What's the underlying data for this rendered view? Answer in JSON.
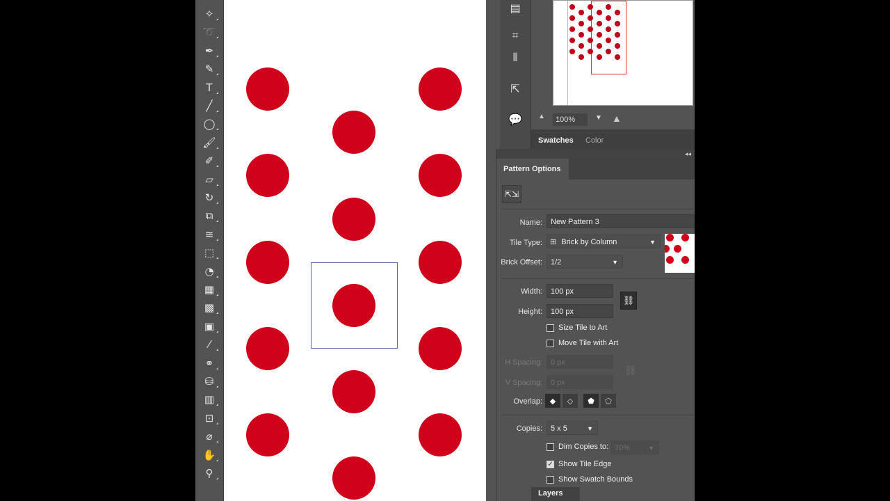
{
  "colors": {
    "panel_bg": "#535353",
    "field_bg": "#454545",
    "dot_red": "#d0021b",
    "tile_edge": "#5a64a0"
  },
  "toolbar": {
    "tools": [
      {
        "name": "magic-wand-icon",
        "glyph": "✧"
      },
      {
        "name": "lasso-icon",
        "glyph": "➰"
      },
      {
        "name": "pen-icon",
        "glyph": "✒"
      },
      {
        "name": "curvature-icon",
        "glyph": "✎"
      },
      {
        "name": "type-icon",
        "glyph": "T"
      },
      {
        "name": "line-icon",
        "glyph": "╱"
      },
      {
        "name": "ellipse-icon",
        "glyph": "◯"
      },
      {
        "name": "paintbrush-icon",
        "glyph": "🖌"
      },
      {
        "name": "shaper-icon",
        "glyph": "✐"
      },
      {
        "name": "eraser-icon",
        "glyph": "▱"
      },
      {
        "name": "rotate-icon",
        "glyph": "↻"
      },
      {
        "name": "scale-icon",
        "glyph": "⧉"
      },
      {
        "name": "warp-icon",
        "glyph": "≋"
      },
      {
        "name": "free-transform-icon",
        "glyph": "⬚"
      },
      {
        "name": "shape-builder-icon",
        "glyph": "◔"
      },
      {
        "name": "perspective-grid-icon",
        "glyph": "▦"
      },
      {
        "name": "mesh-icon",
        "glyph": "▩"
      },
      {
        "name": "gradient-icon",
        "glyph": "▣"
      },
      {
        "name": "eyedropper-icon",
        "glyph": "⁄"
      },
      {
        "name": "blend-icon",
        "glyph": "⚭"
      },
      {
        "name": "symbol-sprayer-icon",
        "glyph": "⛁"
      },
      {
        "name": "column-graph-icon",
        "glyph": "▥"
      },
      {
        "name": "artboard-icon",
        "glyph": "⊡"
      },
      {
        "name": "slice-icon",
        "glyph": "⌀"
      },
      {
        "name": "hand-icon",
        "glyph": "✋"
      },
      {
        "name": "zoom-icon",
        "glyph": "⚲"
      }
    ]
  },
  "dock_icons": [
    {
      "name": "gradient-panel-icon",
      "glyph": "▤"
    },
    {
      "name": "transform-panel-icon",
      "glyph": "⌗"
    },
    {
      "name": "align-panel-icon",
      "glyph": "⫴"
    },
    {
      "name": "export-panel-icon",
      "glyph": "⇱"
    },
    {
      "name": "comments-panel-icon",
      "glyph": "💬"
    }
  ],
  "navigator": {
    "zoom": "100%"
  },
  "panel_tabs": {
    "swatches": "Swatches",
    "color": "Color"
  },
  "pattern_options": {
    "title": "Pattern Options",
    "name_label": "Name:",
    "name_value": "New Pattern 3",
    "tile_type_label": "Tile Type:",
    "tile_type_value": "Brick by Column",
    "brick_offset_label": "Brick Offset:",
    "brick_offset_value": "1/2",
    "width_label": "Width:",
    "width_value": "100 px",
    "height_label": "Height:",
    "height_value": "100 px",
    "size_tile_to_art": "Size Tile to Art",
    "move_tile_with_art": "Move Tile with Art",
    "h_spacing_label": "H Spacing:",
    "h_spacing_value": "0 px",
    "v_spacing_label": "V Spacing:",
    "v_spacing_value": "0 px",
    "overlap_label": "Overlap:",
    "copies_label": "Copies:",
    "copies_value": "5 x 5",
    "dim_copies_label": "Dim Copies to:",
    "dim_copies_value": "70%",
    "show_tile_edge": "Show Tile Edge",
    "show_swatch_bounds": "Show Swatch Bounds",
    "show_tile_edge_checked": true,
    "layers_label": "Layers"
  }
}
